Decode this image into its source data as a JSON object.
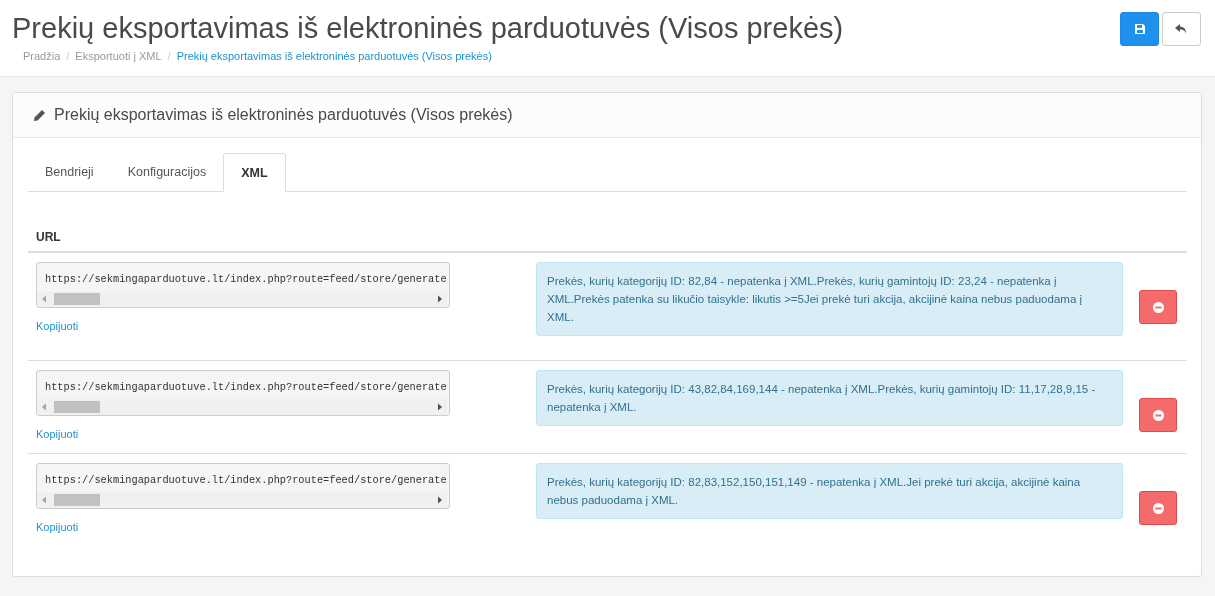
{
  "header": {
    "title": "Prekių eksportavimas iš elektroninės parduotuvės (Visos prekės)",
    "breadcrumbs": [
      {
        "label": "Pradžia",
        "current": false
      },
      {
        "separator": "/",
        "label": "Eksportuoti į XML",
        "current": false
      },
      {
        "separator": "/",
        "label": "Prekių eksportavimas iš elektroninės parduotuvės (Visos prekės)",
        "current": true
      }
    ]
  },
  "panel": {
    "title": "Prekių eksportavimas iš elektroninės parduotuvės (Visos prekės)"
  },
  "tabs": [
    {
      "label": "Bendrieji",
      "selected": false
    },
    {
      "label": "Konfiguracijos",
      "selected": false
    },
    {
      "label": "XML",
      "selected": true
    }
  ],
  "table": {
    "columns": [
      "URL"
    ],
    "rows": [
      {
        "url": "https://sekmingaparduotuve.lt/index.php?route=feed/store/generate",
        "copy": "Kopijuoti",
        "info": "Prekės, kurių kategorijų ID: 82,84 - nepatenka į XML.Prekės, kurių gamintojų ID: 23,24 - nepatenka į XML.Prekės patenka su likučio taisykle: likutis >=5Jei prekė turi akcija, akcijinė kaina nebus paduodama į XML."
      },
      {
        "url": "https://sekmingaparduotuve.lt/index.php?route=feed/store/generate",
        "copy": "Kopijuoti",
        "info": "Prekės, kurių kategorijų ID: 43,82,84,169,144 - nepatenka į XML.Prekės, kurių gamintojų ID: 11,17,28,9,15 - nepatenka į XML."
      },
      {
        "url": "https://sekmingaparduotuve.lt/index.php?route=feed/store/generate",
        "copy": "Kopijuoti",
        "info": "Prekės, kurių kategorijų ID: 82,83,152,150,151,149 - nepatenka į XML.Jei prekė turi akcija, akcijinė kaina nebus paduodama į XML."
      }
    ]
  }
}
